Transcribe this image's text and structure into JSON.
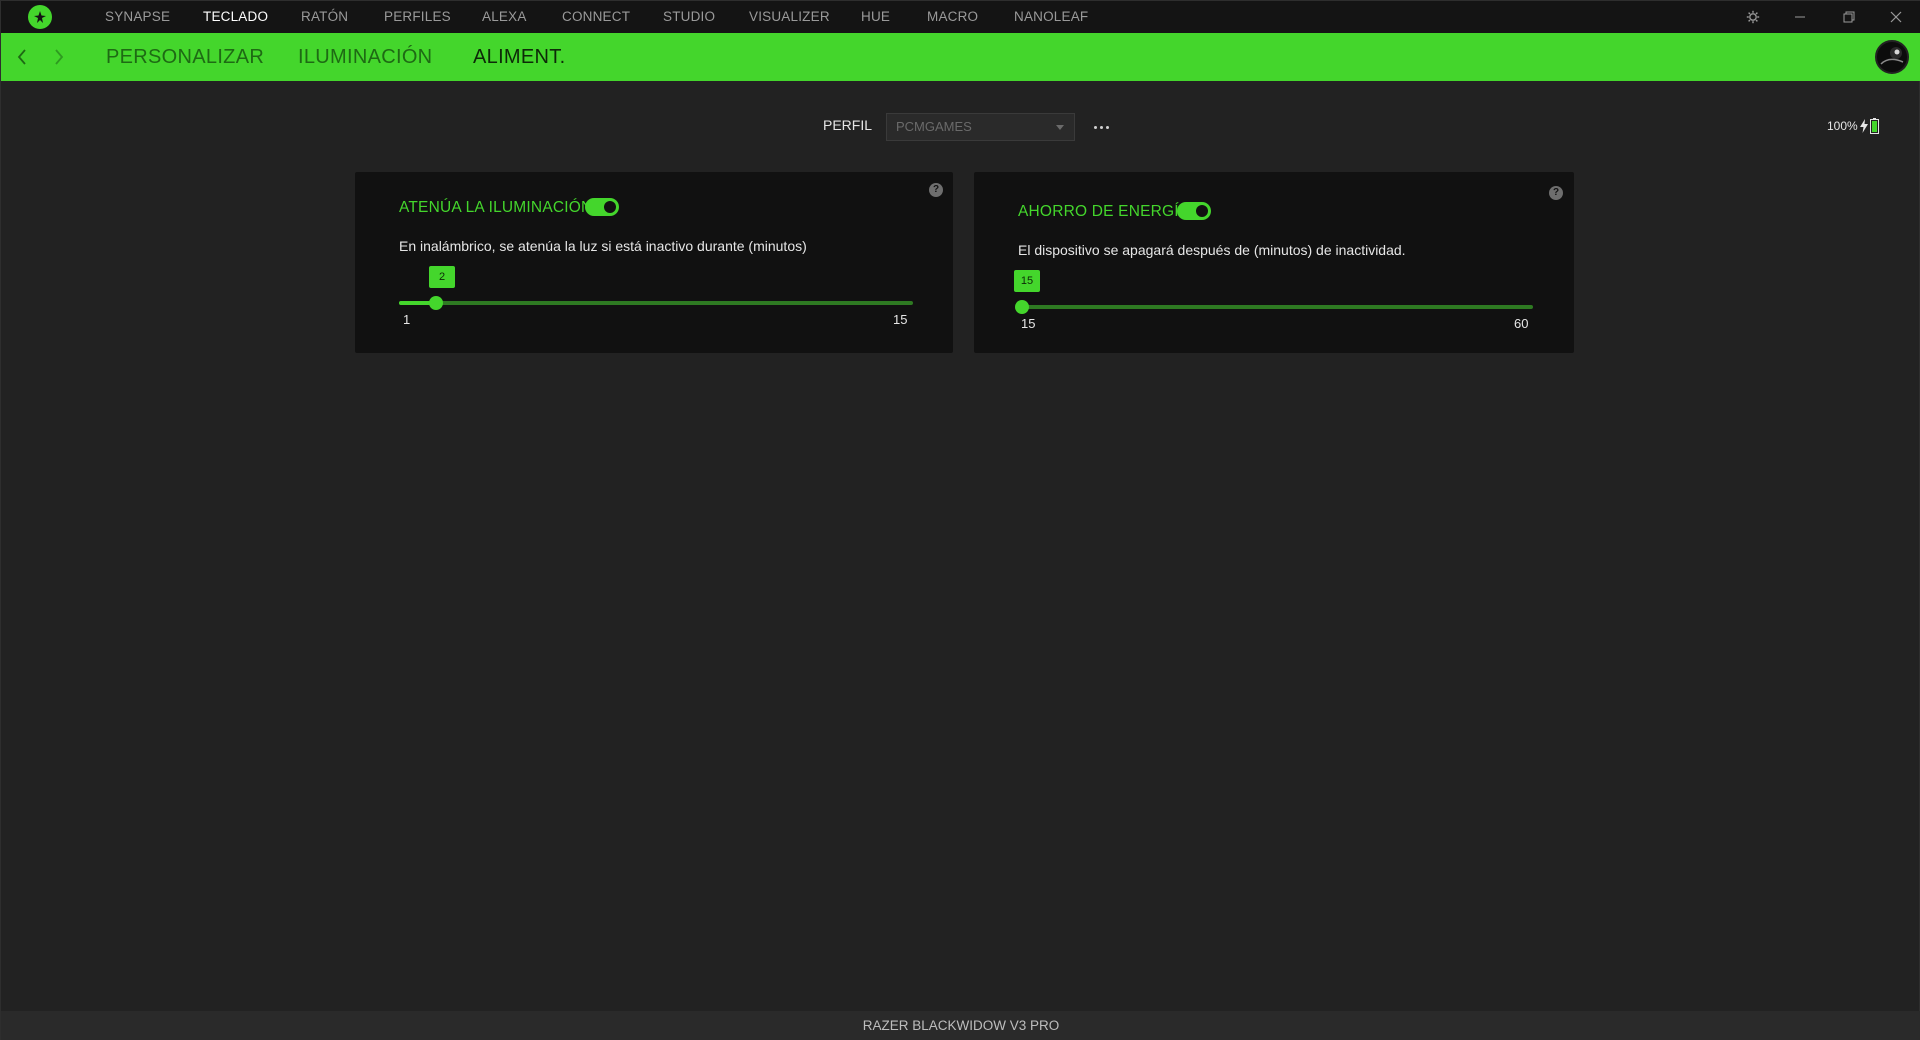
{
  "nav": {
    "items": [
      "SYNAPSE",
      "TECLADO",
      "RATÓN",
      "PERFILES",
      "ALEXA",
      "CONNECT",
      "STUDIO",
      "VISUALIZER",
      "HUE",
      "MACRO",
      "NANOLEAF"
    ],
    "active": "TECLADO"
  },
  "window_controls": [
    "gear-icon",
    "minimize-icon",
    "restore-icon",
    "close-icon"
  ],
  "subnav": {
    "tabs": [
      "PERSONALIZAR",
      "ILUMINACIÓN",
      "ALIMENT."
    ],
    "active": "ALIMENT."
  },
  "profile": {
    "label": "PERFIL",
    "value": "PCMGAMES"
  },
  "battery": {
    "percent_label": "100%",
    "charging": true
  },
  "cards": {
    "dim": {
      "title": "ATENÚA LA ILUMINACIÓN",
      "enabled": true,
      "description": "En inalámbrico, se atenúa la luz si está inactivo durante (minutos)",
      "min": "1",
      "max": "15",
      "value": "2",
      "fraction": 0.0714
    },
    "power": {
      "title": "AHORRO DE ENERGÍA",
      "enabled": true,
      "description": "El dispositivo se apagará después de (minutos) de inactividad.",
      "min": "15",
      "max": "60",
      "value": "15",
      "fraction": 0
    }
  },
  "footer": {
    "device": "RAZER BLACKWIDOW V3 PRO"
  },
  "colors": {
    "accent": "#44d62c",
    "background": "#222222",
    "card": "#111111"
  }
}
